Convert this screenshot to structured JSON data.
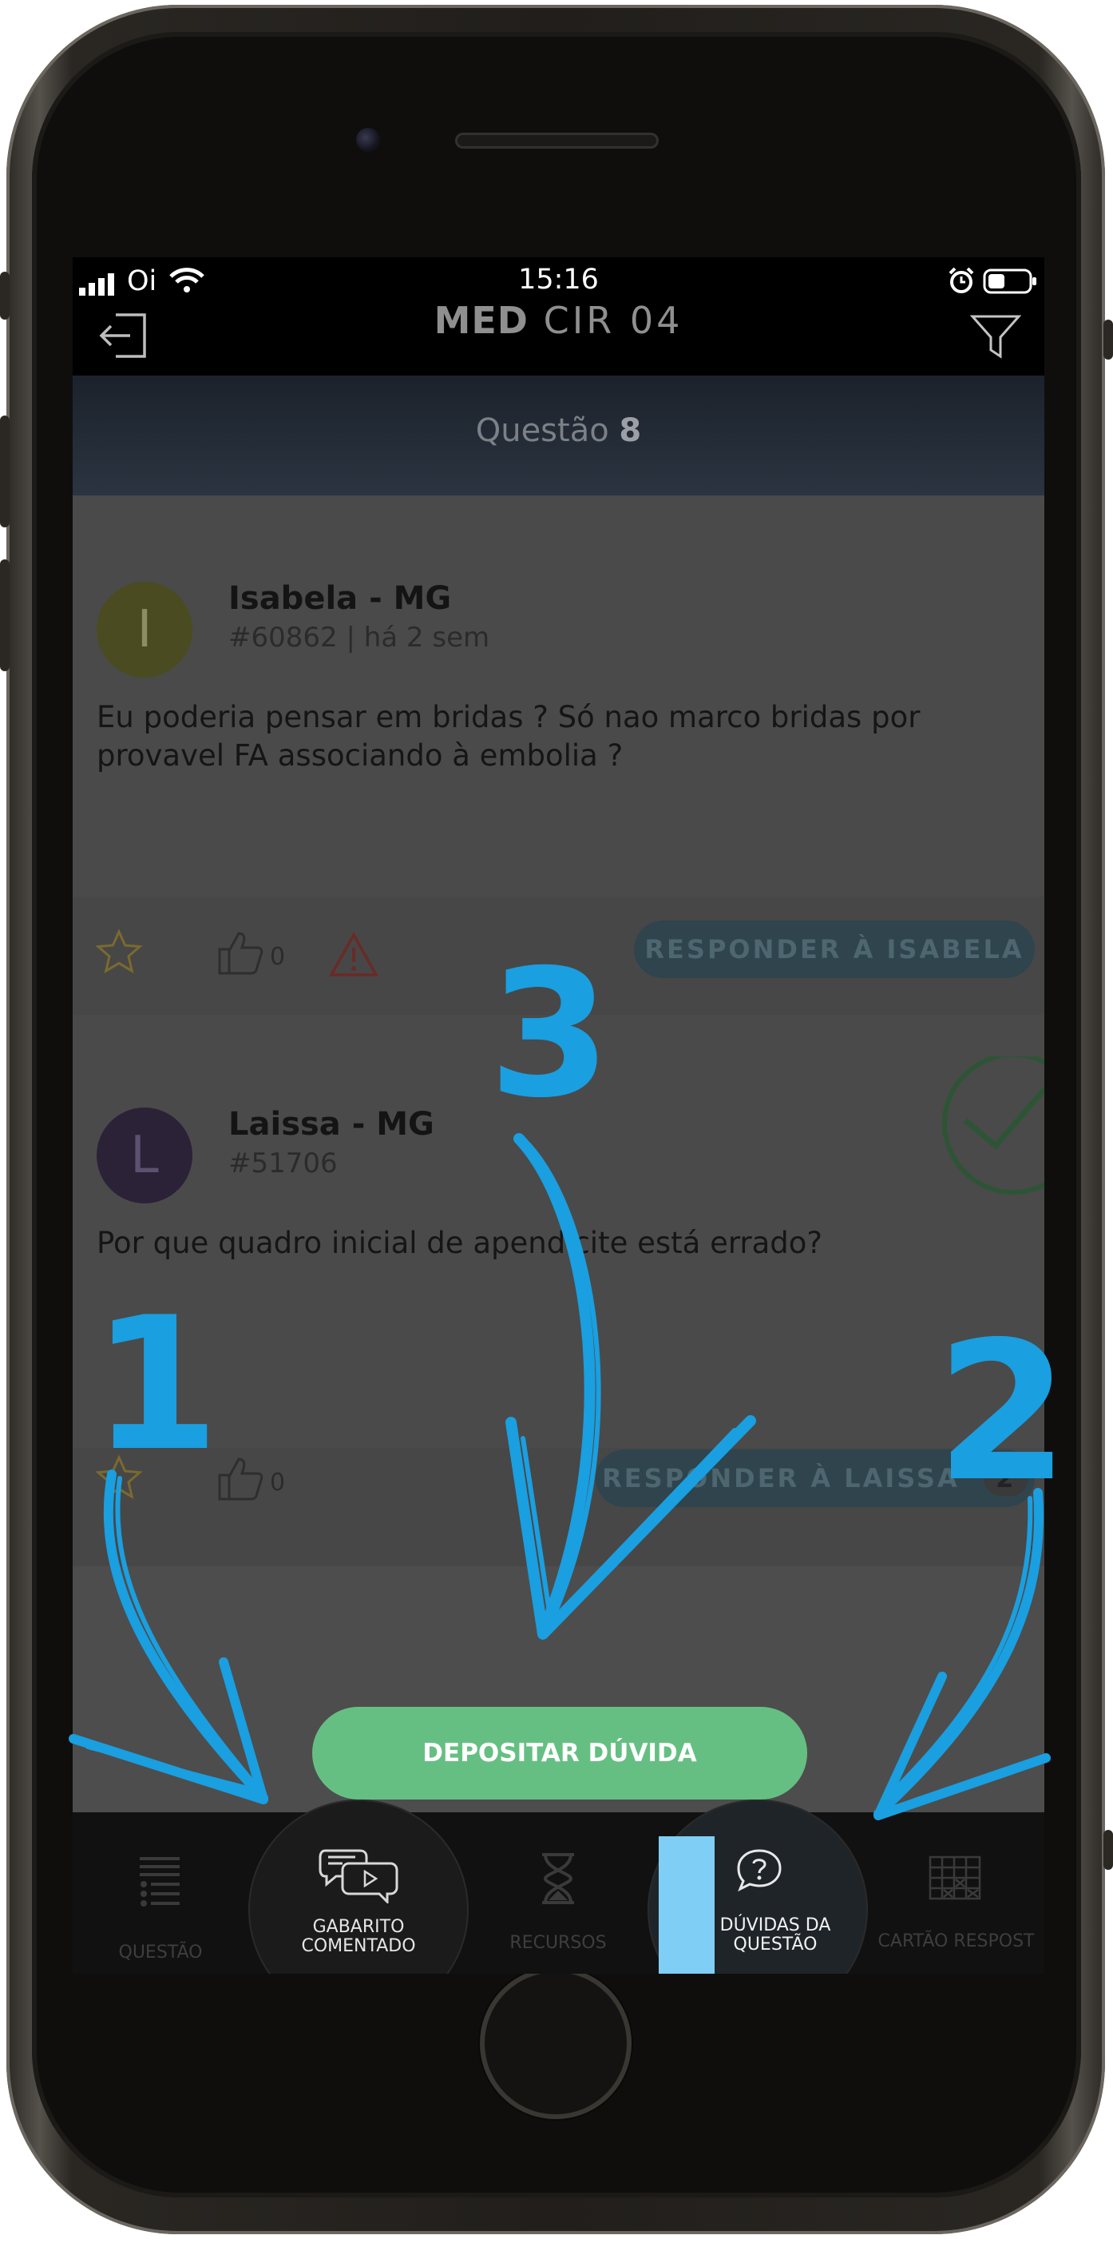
{
  "status_bar": {
    "carrier": "Oi",
    "time": "15:16"
  },
  "header": {
    "title_bold": "MED",
    "title_rest": "CIR 04",
    "back_icon": "exit-icon",
    "filter_icon": "filter-icon"
  },
  "question_banner": {
    "label": "Questão",
    "number": "8"
  },
  "posts": [
    {
      "avatar_letter": "I",
      "author": "Isabela - MG",
      "meta": "#60862 | há 2 sem",
      "text": "Eu poderia pensar em bridas ? Só nao marco bridas por provavel FA associando à embolia ?",
      "likes": "0",
      "reply_label": "RESPONDER À ISABELA"
    },
    {
      "avatar_letter": "L",
      "author": "Laissa - MG",
      "meta": "#51706",
      "text": "Por que quadro inicial de apendicite está errado?",
      "likes": "0",
      "reply_label": "RESPONDER À LAISSA",
      "reply_count": "2"
    }
  ],
  "fab_label": "DEPOSITAR DÚVIDA",
  "tabs": [
    {
      "label": "QUESTÃO",
      "icon": "list-icon"
    },
    {
      "label_line1": "GABARITO",
      "label_line2": "COMENTADO",
      "icon": "video-comment-icon"
    },
    {
      "label": "RECURSOS",
      "icon": "hourglass-icon"
    },
    {
      "label_line1": "DÚVIDAS DA",
      "label_line2": "QUESTÃO",
      "icon": "question-bubble-icon"
    },
    {
      "label": "CARTÃO RESPOST",
      "icon": "answer-grid-icon"
    }
  ],
  "annotations": [
    "1",
    "2",
    "3"
  ],
  "colors": {
    "accent_green": "#66bf82",
    "annotation_blue": "#1a9fe0",
    "active_tab_blue": "#7fcef5"
  }
}
